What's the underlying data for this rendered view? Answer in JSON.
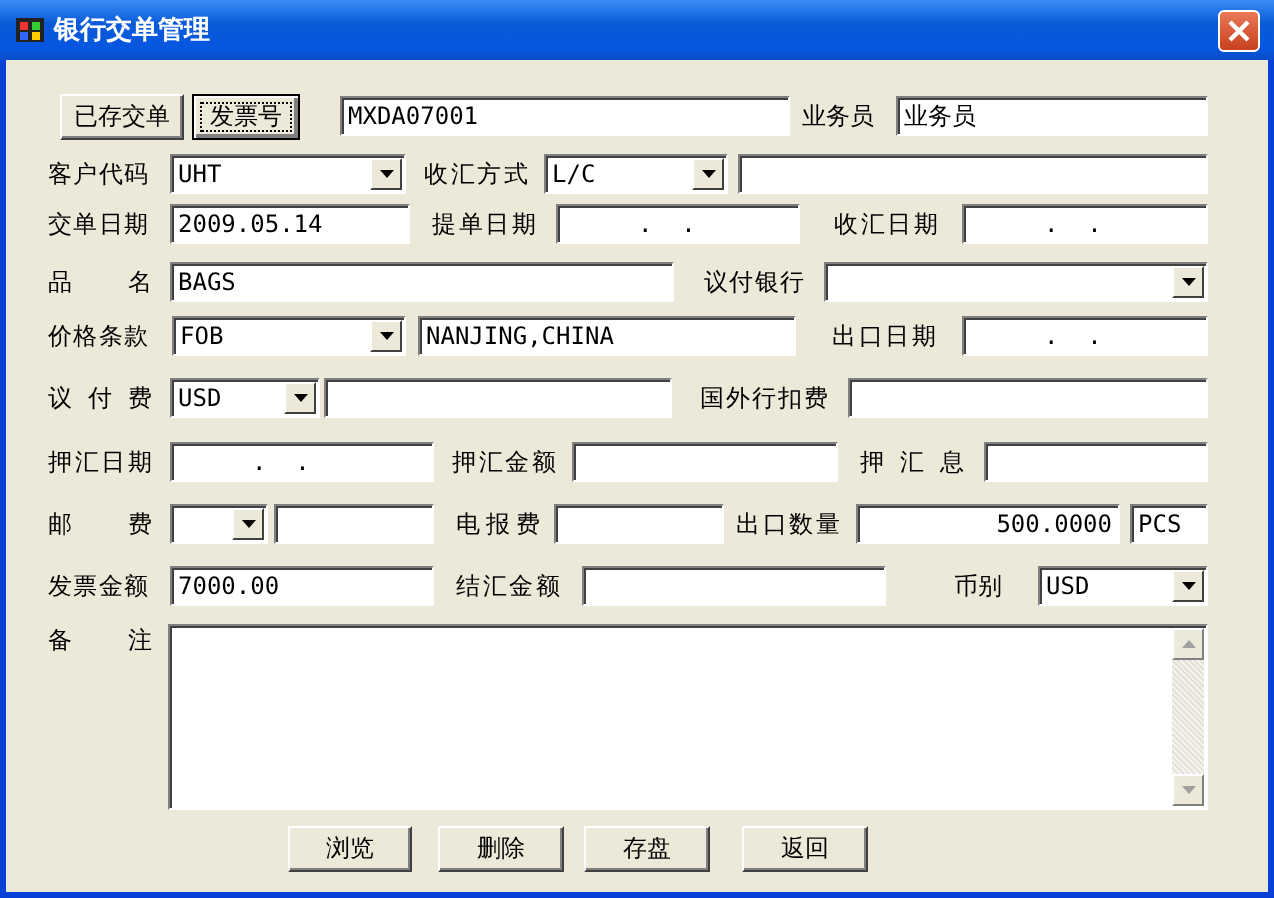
{
  "window": {
    "title": "银行交单管理"
  },
  "rows": [
    [
      {
        "kind": "button",
        "label": "已存交单",
        "focused": false
      },
      {
        "kind": "button",
        "label": "发票号",
        "focused": true
      },
      {
        "kind": "field",
        "value": "MXDA07001"
      },
      {
        "kind": "label",
        "text": "业务员"
      },
      {
        "kind": "field",
        "value": "业务员"
      }
    ],
    [
      {
        "kind": "label",
        "text": "客户代码"
      },
      {
        "kind": "combo",
        "value": "UHT"
      },
      {
        "kind": "label",
        "text": "收汇方式"
      },
      {
        "kind": "combo",
        "value": "L/C"
      },
      {
        "kind": "field"
      }
    ],
    [
      {
        "kind": "label",
        "text": "交单日期"
      },
      {
        "kind": "field",
        "value": "2009.05.14"
      },
      {
        "kind": "label",
        "text": "提单日期"
      },
      {
        "kind": "date",
        "value": ".  ."
      },
      {
        "kind": "label",
        "text": "收汇日期"
      },
      {
        "kind": "date",
        "value": ".  ."
      }
    ],
    [
      {
        "kind": "label",
        "text": "品 名"
      },
      {
        "kind": "field",
        "value": "BAGS"
      },
      {
        "kind": "label",
        "text": "议付银行"
      },
      {
        "kind": "combo"
      }
    ],
    [
      {
        "kind": "label",
        "text": "价格条款"
      },
      {
        "kind": "combo",
        "value": "FOB"
      },
      {
        "kind": "field",
        "value": "NANJING,CHINA"
      },
      {
        "kind": "label",
        "text": "出口日期"
      },
      {
        "kind": "date",
        "value": ".  ."
      }
    ],
    [
      {
        "kind": "label",
        "text": "议 付 费"
      },
      {
        "kind": "combo",
        "value": "USD"
      },
      {
        "kind": "field"
      },
      {
        "kind": "label",
        "text": "国外行扣费"
      },
      {
        "kind": "field"
      }
    ],
    [
      {
        "kind": "label",
        "text": "押汇日期"
      },
      {
        "kind": "date",
        "value": ".  ."
      },
      {
        "kind": "label",
        "text": "押汇金额"
      },
      {
        "kind": "field"
      },
      {
        "kind": "label",
        "text": "押 汇 息"
      },
      {
        "kind": "field"
      }
    ],
    [
      {
        "kind": "label",
        "text": "邮 费"
      },
      {
        "kind": "combo"
      },
      {
        "kind": "field"
      },
      {
        "kind": "label",
        "text": "电报费"
      },
      {
        "kind": "field"
      },
      {
        "kind": "label",
        "text": "出口数量"
      },
      {
        "kind": "number",
        "value": "500.0000"
      },
      {
        "kind": "field",
        "value": "PCS"
      }
    ],
    [
      {
        "kind": "label",
        "text": "发票金额"
      },
      {
        "kind": "field",
        "value": "7000.00"
      },
      {
        "kind": "label",
        "text": "结汇金额"
      },
      {
        "kind": "field"
      },
      {
        "kind": "label",
        "text": "币别"
      },
      {
        "kind": "combo",
        "value": "USD"
      }
    ]
  ],
  "notes": {
    "label": "备 注"
  },
  "buttons": [
    {
      "label": "浏览"
    },
    {
      "label": "删除"
    },
    {
      "label": "存盘"
    },
    {
      "label": "返回"
    }
  ]
}
